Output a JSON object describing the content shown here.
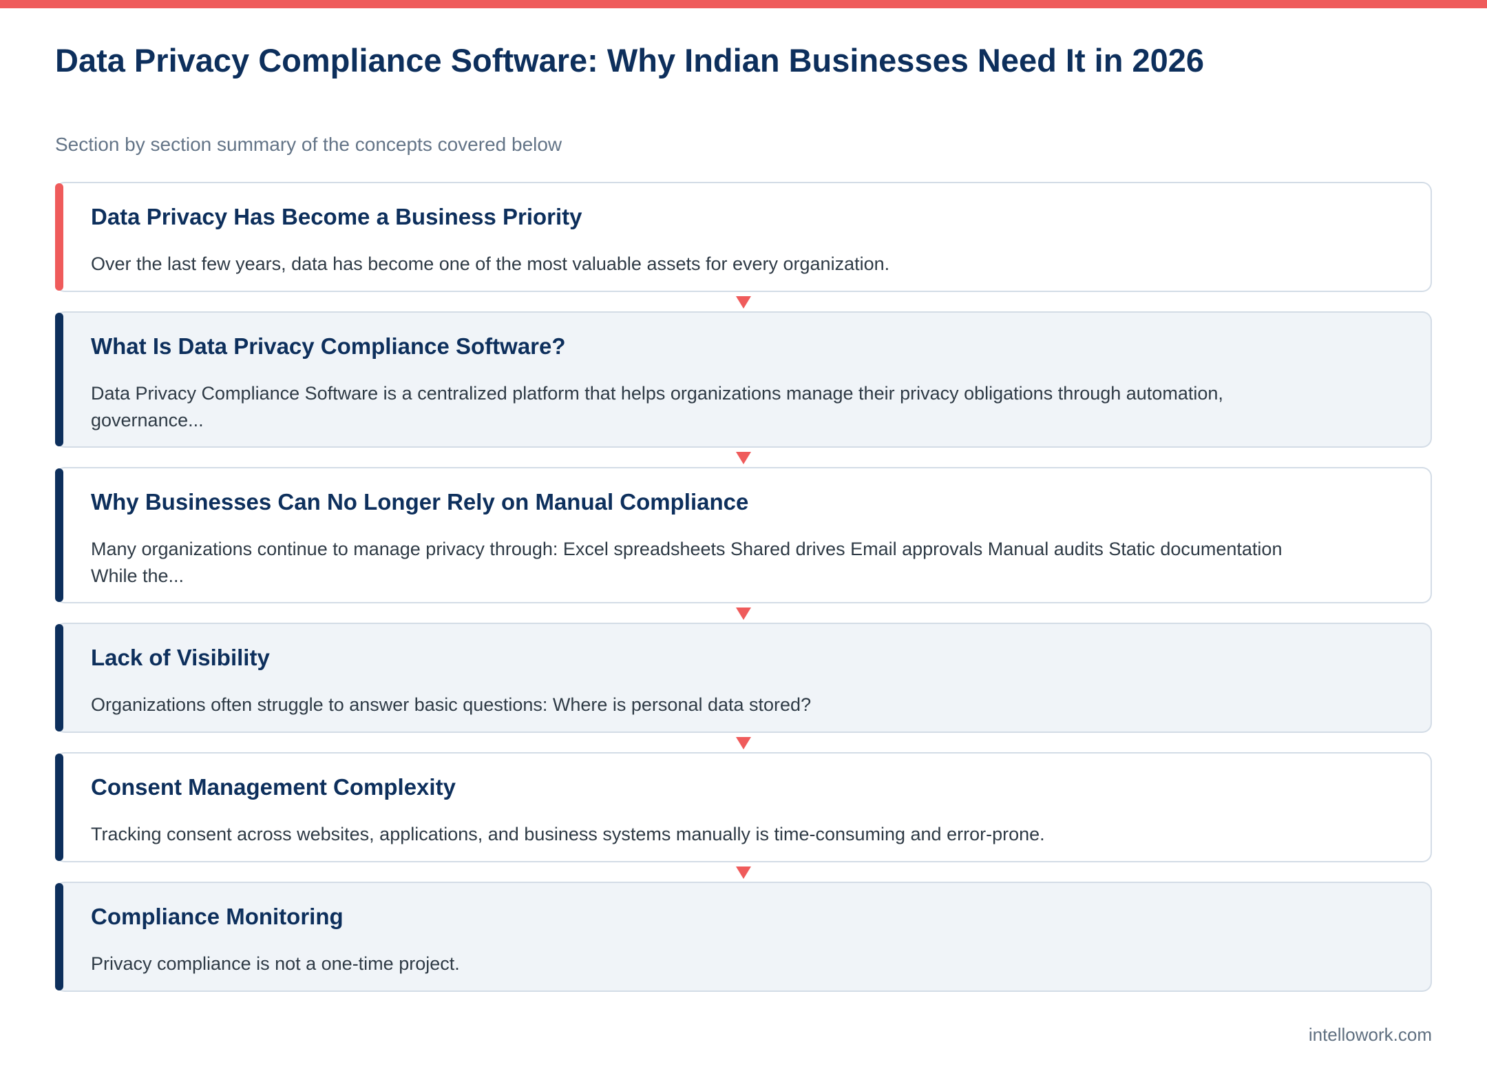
{
  "title": "Data Privacy Compliance Software: Why Indian Businesses Need It in 2026",
  "subtitle": "Section by section summary of the concepts covered below",
  "colors": {
    "accent_red": "#ef5b5b",
    "navy": "#0d2f5c",
    "card_alt_bg": "#f0f4f8"
  },
  "sections": [
    {
      "title": "Data Privacy Has Become a Business Priority",
      "text": "Over the last few years, data has become one of the most valuable assets for every organization."
    },
    {
      "title": "What Is Data Privacy Compliance Software?",
      "text": "Data Privacy Compliance Software is a centralized platform that helps organizations manage their privacy obligations through automation, governance..."
    },
    {
      "title": "Why Businesses Can No Longer Rely on Manual Compliance",
      "text": "Many organizations continue to manage privacy through: Excel spreadsheets Shared drives Email approvals Manual audits Static documentation While the..."
    },
    {
      "title": "Lack of Visibility",
      "text": "Organizations often struggle to answer basic questions: Where is personal data stored?"
    },
    {
      "title": "Consent Management Complexity",
      "text": "Tracking consent across websites, applications, and business systems manually is time-consuming and error-prone."
    },
    {
      "title": "Compliance Monitoring",
      "text": "Privacy compliance is not a one-time project."
    }
  ],
  "connector_icon": "down-arrow-icon",
  "source": "intellowork.com"
}
